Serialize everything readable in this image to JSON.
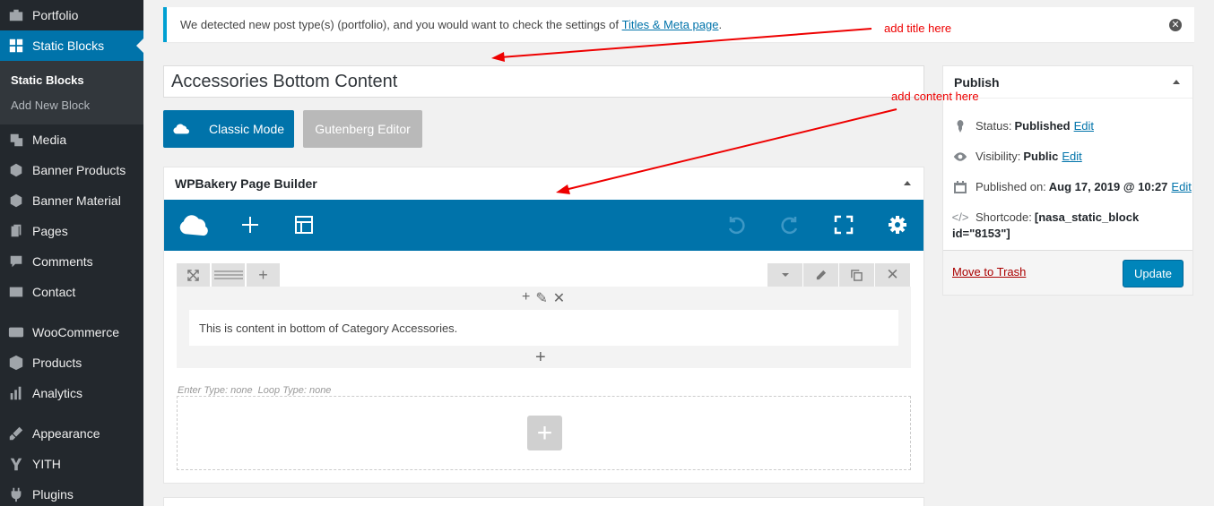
{
  "sidebar": {
    "items": [
      {
        "label": "Portfolio",
        "icon": "portfolio-icon"
      },
      {
        "label": "Static Blocks",
        "icon": "blocks-icon",
        "active": true
      },
      {
        "label": "Media",
        "icon": "media-icon"
      },
      {
        "label": "Banner Products",
        "icon": "pin-icon"
      },
      {
        "label": "Banner Material",
        "icon": "pin-icon"
      },
      {
        "label": "Pages",
        "icon": "pages-icon"
      },
      {
        "label": "Comments",
        "icon": "comments-icon"
      },
      {
        "label": "Contact",
        "icon": "mail-icon"
      },
      {
        "label": "WooCommerce",
        "icon": "woo-icon"
      },
      {
        "label": "Products",
        "icon": "products-icon"
      },
      {
        "label": "Analytics",
        "icon": "analytics-icon"
      },
      {
        "label": "Appearance",
        "icon": "brush-icon"
      },
      {
        "label": "YITH",
        "icon": "yith-icon"
      },
      {
        "label": "Plugins",
        "icon": "plugin-icon"
      }
    ],
    "submenu": [
      {
        "label": "Static Blocks",
        "current": true
      },
      {
        "label": "Add New Block"
      }
    ]
  },
  "notice": {
    "text": "We detected new post type(s) (portfolio), and you would want to check the settings of ",
    "link": "Titles & Meta page",
    "suffix": "."
  },
  "post": {
    "title": "Accessories Bottom Content"
  },
  "editor_modes": {
    "classic": "Classic Mode",
    "gutenberg": "Gutenberg Editor"
  },
  "wpbakery": {
    "title": "WPBakery Page Builder",
    "text_block": "This is content in bottom of Category Accessories.",
    "meta": "Enter Type: none  Loop Type: none"
  },
  "publish": {
    "title": "Publish",
    "status_label": "Status:",
    "status_value": "Published",
    "visibility_label": "Visibility:",
    "visibility_value": "Public",
    "published_label": "Published on:",
    "published_value": "Aug 17, 2019 @ 10:27",
    "shortcode_label": "Shortcode:",
    "shortcode_value": "[nasa_static_block",
    "shortcode_value2": "id=\"8153\"]",
    "edit": "Edit",
    "trash": "Move to Trash",
    "update": "Update"
  },
  "annotations": {
    "title_note": "add title here",
    "content_note": "add content here"
  },
  "colors": {
    "sidebar_bg": "#23282d",
    "accent": "#0073aa",
    "annotation": "#e00000"
  }
}
